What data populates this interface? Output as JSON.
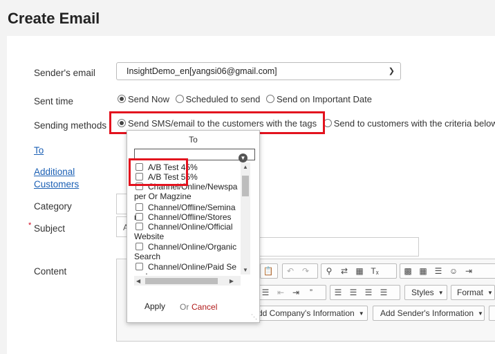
{
  "page": {
    "title": "Create Email"
  },
  "form": {
    "senders_email_label": "Sender's email",
    "senders_email_value": "InsightDemo_en[yangsi06@gmail.com]",
    "sent_time_label": "Sent time",
    "sent_time_options": [
      "Send Now",
      "Scheduled to send",
      "Send on Important Date"
    ],
    "sending_methods_label": "Sending methods",
    "sending_methods_options": [
      "Send SMS/email to the customers with the tags",
      "Send to customers with the criteria below"
    ],
    "to_label": "To",
    "additional_label_1": "Additional",
    "additional_label_2": "Customers",
    "category_label": "Category",
    "subject_label": "Subject",
    "content_label": "Content",
    "subject_partial": "A"
  },
  "popup": {
    "title": "To",
    "items": [
      "A/B Test 45%",
      "A/B Test 55%",
      "Channel/Online/Newspaper Or Magzine",
      "Channel/Offline/Seminar",
      "Channel/Offline/Stores",
      "Channel/Online/Official Website",
      "Channel/Online/Organic Search",
      "Channel/Online/Paid Search"
    ],
    "apply_label": "Apply",
    "or_label": "Or",
    "cancel_label": "Cancel"
  },
  "editor": {
    "styles_label": "Styles",
    "format_label": "Format",
    "add_company_info_label": "dd Company's Information",
    "add_sender_info_label": "Add Sender's Information"
  }
}
